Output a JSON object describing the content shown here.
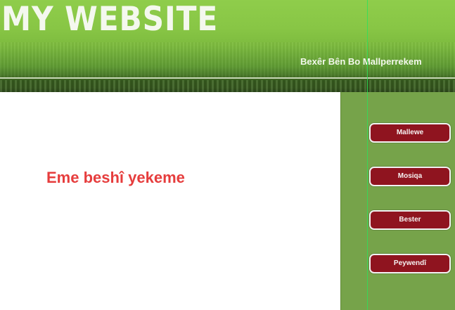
{
  "header": {
    "site_title": "MY WEBSITE",
    "tagline": "Bexêr Bên Bo Mallperrekem"
  },
  "main": {
    "heading": "Eme beshî yekeme"
  },
  "sidebar": {
    "nav": [
      {
        "label": "Mallewe"
      },
      {
        "label": "Mosiqa"
      },
      {
        "label": "Bester"
      },
      {
        "label": "Peywendî"
      }
    ]
  },
  "colors": {
    "header_green": "#88c645",
    "header_dark": "#3a5e21",
    "sidebar_green": "#76a34a",
    "button_red": "#8f141f",
    "heading_red": "#e63d3d",
    "guide_line": "#2ee05a"
  }
}
